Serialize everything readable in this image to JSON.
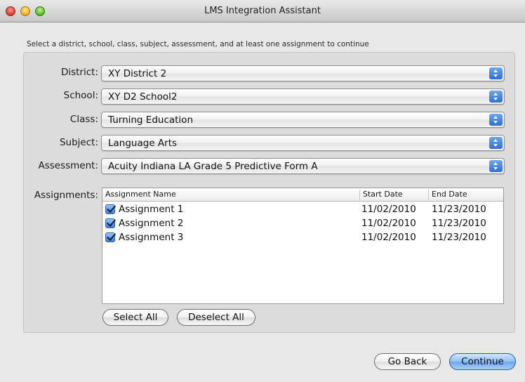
{
  "window": {
    "title": "LMS Integration Assistant"
  },
  "instruction": "Select a district, school, class, subject, assessment, and at least one assignment to continue",
  "fields": [
    {
      "label": "District:",
      "value": "XY District 2"
    },
    {
      "label": "School:",
      "value": "XY D2 School2"
    },
    {
      "label": "Class:",
      "value": "Turning Education"
    },
    {
      "label": "Subject:",
      "value": "Language Arts"
    },
    {
      "label": "Assessment:",
      "value": "Acuity Indiana LA Grade 5 Predictive Form A"
    }
  ],
  "assignments": {
    "label": "Assignments:",
    "columns": [
      "Assignment Name",
      "Start Date",
      "End Date"
    ],
    "rows": [
      {
        "checked": true,
        "name": "Assignment 1",
        "start": "11/02/2010",
        "end": "11/23/2010"
      },
      {
        "checked": true,
        "name": "Assignment 2",
        "start": "11/02/2010",
        "end": "11/23/2010"
      },
      {
        "checked": true,
        "name": "Assignment 3",
        "start": "11/02/2010",
        "end": "11/23/2010"
      }
    ]
  },
  "buttons": {
    "select_all": "Select All",
    "deselect_all": "Deselect All",
    "go_back": "Go Back",
    "continue": "Continue"
  },
  "colors": {
    "accent": "#3c7fde",
    "default_button": "#8fbff4"
  }
}
